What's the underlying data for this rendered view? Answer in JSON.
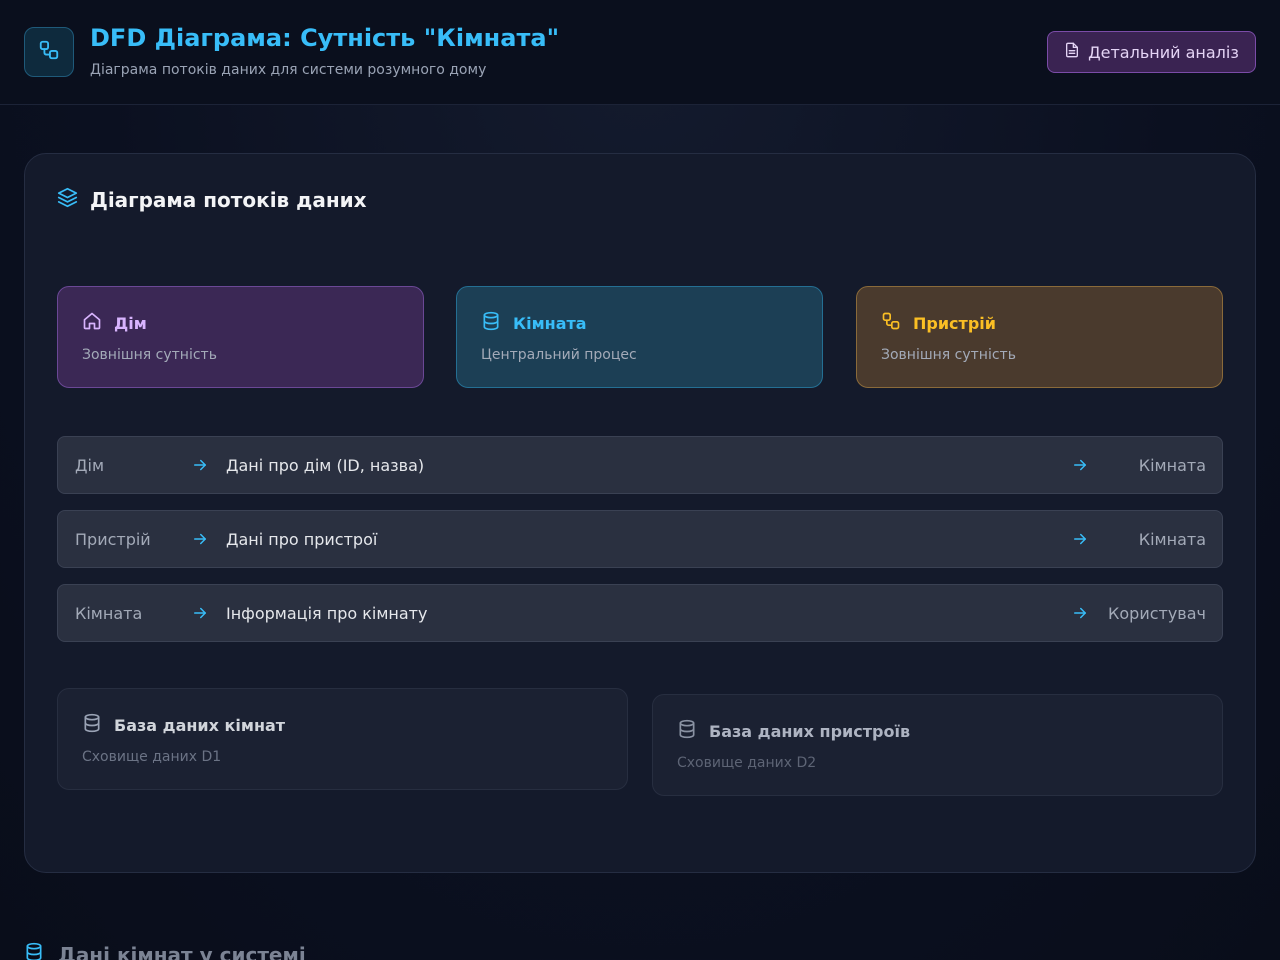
{
  "header": {
    "title": "DFD Діаграма: Сутність \"Кімната\"",
    "subtitle": "Діаграма потоків даних для системи розумного дому",
    "detail_button": "Детальний аналіз",
    "logo_icon": "workflow-icon",
    "detail_icon": "document-icon"
  },
  "diagram": {
    "title": "Діаграма потоків даних",
    "title_icon": "layers-icon",
    "entities": [
      {
        "name": "Дім",
        "type": "Зовнішня сутність",
        "icon": "home-icon",
        "color": "#d8b4fe"
      },
      {
        "name": "Кімната",
        "type": "Центральний процес",
        "icon": "database-icon",
        "color": "#38bdf8"
      },
      {
        "name": "Пристрій",
        "type": "Зовнішня сутність",
        "icon": "workflow-icon",
        "color": "#fbbf24"
      }
    ],
    "flows": [
      {
        "source": "Дім",
        "description": "Дані про дім (ID, назва)",
        "target": "Кімната"
      },
      {
        "source": "Пристрій",
        "description": "Дані про пристрої",
        "target": "Кімната"
      },
      {
        "source": "Кімната",
        "description": "Інформація про кімнату",
        "target": "Користувач"
      }
    ],
    "stores": [
      {
        "name": "База даних кімнат",
        "type": "Сховище даних D1",
        "icon": "database-icon"
      },
      {
        "name": "База даних пристроїв",
        "type": "Сховище даних D2",
        "icon": "database-icon"
      }
    ]
  },
  "section2": {
    "title": "Дані кімнат у системі",
    "icon": "database-icon"
  },
  "colors": {
    "accent": "#38bdf8",
    "purple": "#d8b4fe",
    "amber": "#fbbf24"
  }
}
